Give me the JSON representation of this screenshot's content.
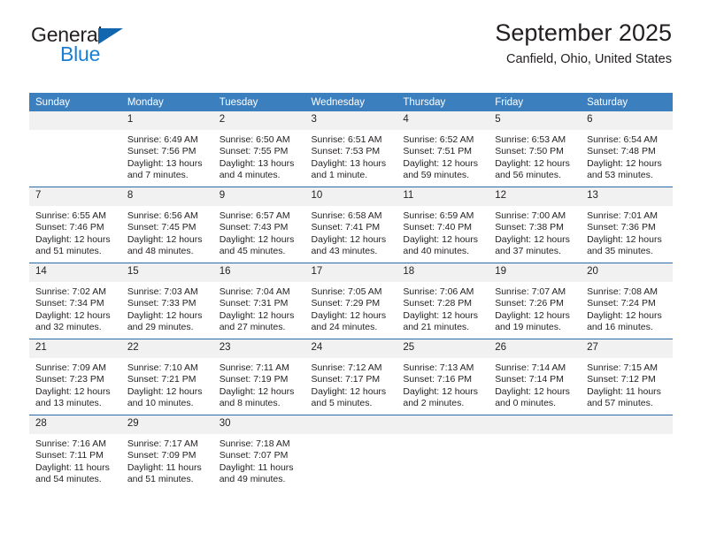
{
  "logo": {
    "line1": "General",
    "line2": "Blue",
    "triangle_color": "#1266ad",
    "blue_color": "#1a7fd4"
  },
  "header": {
    "title": "September 2025",
    "subtitle": "Canfield, Ohio, United States"
  },
  "colors": {
    "header_row_bg": "#3c7fbe",
    "day_number_bg": "#f1f1f1",
    "row_divider": "#2a6ca8",
    "text": "#231f20"
  },
  "weekdays": [
    "Sunday",
    "Monday",
    "Tuesday",
    "Wednesday",
    "Thursday",
    "Friday",
    "Saturday"
  ],
  "labels": {
    "sunrise": "Sunrise:",
    "sunset": "Sunset:",
    "daylight": "Daylight:"
  },
  "weeks": [
    [
      {
        "day": "",
        "empty": true
      },
      {
        "day": "1",
        "sunrise": "Sunrise: 6:49 AM",
        "sunset": "Sunset: 7:56 PM",
        "daylight1": "Daylight: 13 hours",
        "daylight2": "and 7 minutes."
      },
      {
        "day": "2",
        "sunrise": "Sunrise: 6:50 AM",
        "sunset": "Sunset: 7:55 PM",
        "daylight1": "Daylight: 13 hours",
        "daylight2": "and 4 minutes."
      },
      {
        "day": "3",
        "sunrise": "Sunrise: 6:51 AM",
        "sunset": "Sunset: 7:53 PM",
        "daylight1": "Daylight: 13 hours",
        "daylight2": "and 1 minute."
      },
      {
        "day": "4",
        "sunrise": "Sunrise: 6:52 AM",
        "sunset": "Sunset: 7:51 PM",
        "daylight1": "Daylight: 12 hours",
        "daylight2": "and 59 minutes."
      },
      {
        "day": "5",
        "sunrise": "Sunrise: 6:53 AM",
        "sunset": "Sunset: 7:50 PM",
        "daylight1": "Daylight: 12 hours",
        "daylight2": "and 56 minutes."
      },
      {
        "day": "6",
        "sunrise": "Sunrise: 6:54 AM",
        "sunset": "Sunset: 7:48 PM",
        "daylight1": "Daylight: 12 hours",
        "daylight2": "and 53 minutes."
      }
    ],
    [
      {
        "day": "7",
        "sunrise": "Sunrise: 6:55 AM",
        "sunset": "Sunset: 7:46 PM",
        "daylight1": "Daylight: 12 hours",
        "daylight2": "and 51 minutes."
      },
      {
        "day": "8",
        "sunrise": "Sunrise: 6:56 AM",
        "sunset": "Sunset: 7:45 PM",
        "daylight1": "Daylight: 12 hours",
        "daylight2": "and 48 minutes."
      },
      {
        "day": "9",
        "sunrise": "Sunrise: 6:57 AM",
        "sunset": "Sunset: 7:43 PM",
        "daylight1": "Daylight: 12 hours",
        "daylight2": "and 45 minutes."
      },
      {
        "day": "10",
        "sunrise": "Sunrise: 6:58 AM",
        "sunset": "Sunset: 7:41 PM",
        "daylight1": "Daylight: 12 hours",
        "daylight2": "and 43 minutes."
      },
      {
        "day": "11",
        "sunrise": "Sunrise: 6:59 AM",
        "sunset": "Sunset: 7:40 PM",
        "daylight1": "Daylight: 12 hours",
        "daylight2": "and 40 minutes."
      },
      {
        "day": "12",
        "sunrise": "Sunrise: 7:00 AM",
        "sunset": "Sunset: 7:38 PM",
        "daylight1": "Daylight: 12 hours",
        "daylight2": "and 37 minutes."
      },
      {
        "day": "13",
        "sunrise": "Sunrise: 7:01 AM",
        "sunset": "Sunset: 7:36 PM",
        "daylight1": "Daylight: 12 hours",
        "daylight2": "and 35 minutes."
      }
    ],
    [
      {
        "day": "14",
        "sunrise": "Sunrise: 7:02 AM",
        "sunset": "Sunset: 7:34 PM",
        "daylight1": "Daylight: 12 hours",
        "daylight2": "and 32 minutes."
      },
      {
        "day": "15",
        "sunrise": "Sunrise: 7:03 AM",
        "sunset": "Sunset: 7:33 PM",
        "daylight1": "Daylight: 12 hours",
        "daylight2": "and 29 minutes."
      },
      {
        "day": "16",
        "sunrise": "Sunrise: 7:04 AM",
        "sunset": "Sunset: 7:31 PM",
        "daylight1": "Daylight: 12 hours",
        "daylight2": "and 27 minutes."
      },
      {
        "day": "17",
        "sunrise": "Sunrise: 7:05 AM",
        "sunset": "Sunset: 7:29 PM",
        "daylight1": "Daylight: 12 hours",
        "daylight2": "and 24 minutes."
      },
      {
        "day": "18",
        "sunrise": "Sunrise: 7:06 AM",
        "sunset": "Sunset: 7:28 PM",
        "daylight1": "Daylight: 12 hours",
        "daylight2": "and 21 minutes."
      },
      {
        "day": "19",
        "sunrise": "Sunrise: 7:07 AM",
        "sunset": "Sunset: 7:26 PM",
        "daylight1": "Daylight: 12 hours",
        "daylight2": "and 19 minutes."
      },
      {
        "day": "20",
        "sunrise": "Sunrise: 7:08 AM",
        "sunset": "Sunset: 7:24 PM",
        "daylight1": "Daylight: 12 hours",
        "daylight2": "and 16 minutes."
      }
    ],
    [
      {
        "day": "21",
        "sunrise": "Sunrise: 7:09 AM",
        "sunset": "Sunset: 7:23 PM",
        "daylight1": "Daylight: 12 hours",
        "daylight2": "and 13 minutes."
      },
      {
        "day": "22",
        "sunrise": "Sunrise: 7:10 AM",
        "sunset": "Sunset: 7:21 PM",
        "daylight1": "Daylight: 12 hours",
        "daylight2": "and 10 minutes."
      },
      {
        "day": "23",
        "sunrise": "Sunrise: 7:11 AM",
        "sunset": "Sunset: 7:19 PM",
        "daylight1": "Daylight: 12 hours",
        "daylight2": "and 8 minutes."
      },
      {
        "day": "24",
        "sunrise": "Sunrise: 7:12 AM",
        "sunset": "Sunset: 7:17 PM",
        "daylight1": "Daylight: 12 hours",
        "daylight2": "and 5 minutes."
      },
      {
        "day": "25",
        "sunrise": "Sunrise: 7:13 AM",
        "sunset": "Sunset: 7:16 PM",
        "daylight1": "Daylight: 12 hours",
        "daylight2": "and 2 minutes."
      },
      {
        "day": "26",
        "sunrise": "Sunrise: 7:14 AM",
        "sunset": "Sunset: 7:14 PM",
        "daylight1": "Daylight: 12 hours",
        "daylight2": "and 0 minutes."
      },
      {
        "day": "27",
        "sunrise": "Sunrise: 7:15 AM",
        "sunset": "Sunset: 7:12 PM",
        "daylight1": "Daylight: 11 hours",
        "daylight2": "and 57 minutes."
      }
    ],
    [
      {
        "day": "28",
        "sunrise": "Sunrise: 7:16 AM",
        "sunset": "Sunset: 7:11 PM",
        "daylight1": "Daylight: 11 hours",
        "daylight2": "and 54 minutes."
      },
      {
        "day": "29",
        "sunrise": "Sunrise: 7:17 AM",
        "sunset": "Sunset: 7:09 PM",
        "daylight1": "Daylight: 11 hours",
        "daylight2": "and 51 minutes."
      },
      {
        "day": "30",
        "sunrise": "Sunrise: 7:18 AM",
        "sunset": "Sunset: 7:07 PM",
        "daylight1": "Daylight: 11 hours",
        "daylight2": "and 49 minutes."
      },
      {
        "day": "",
        "empty": true
      },
      {
        "day": "",
        "empty": true
      },
      {
        "day": "",
        "empty": true
      },
      {
        "day": "",
        "empty": true
      }
    ]
  ]
}
